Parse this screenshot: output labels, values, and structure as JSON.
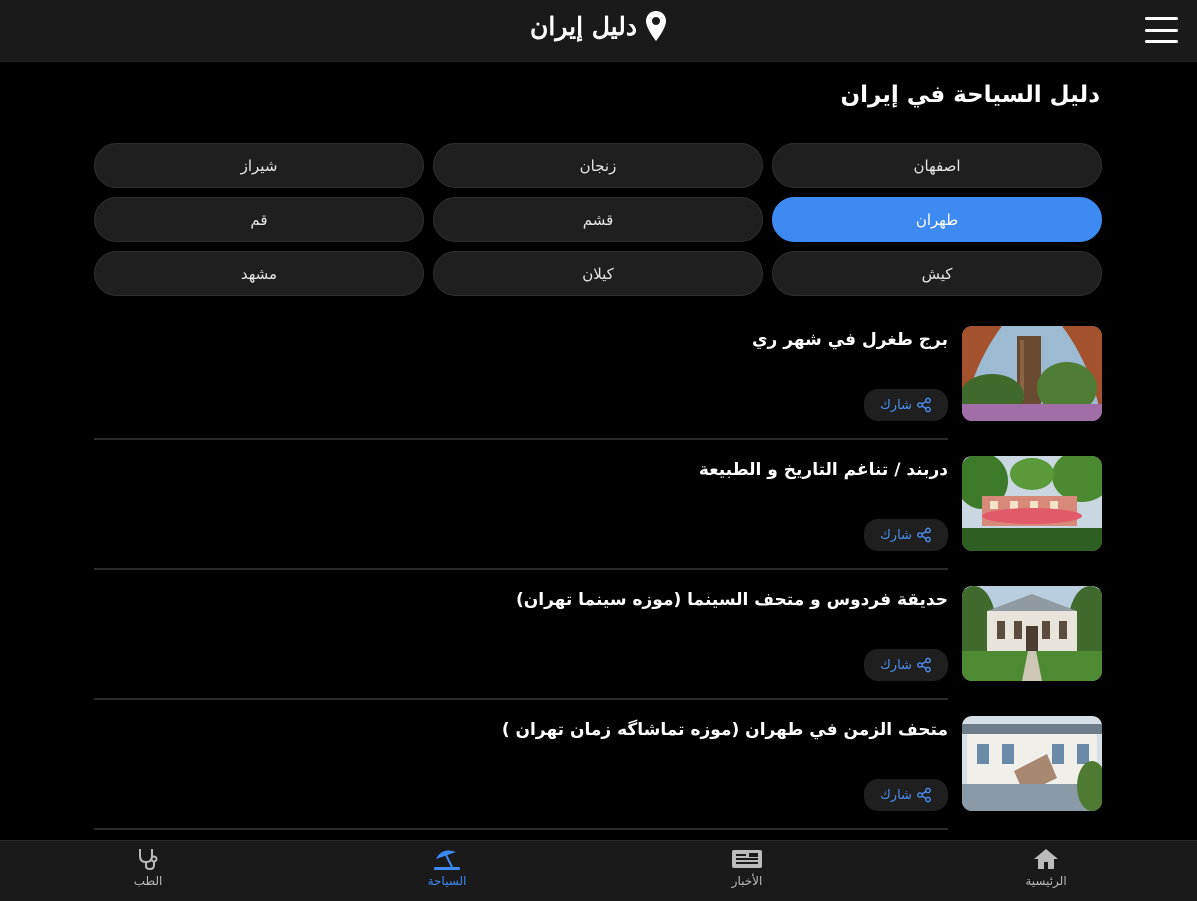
{
  "header": {
    "title": "دليل إيران",
    "logo_icon": "map-pin-icon",
    "menu_icon": "hamburger-menu-icon"
  },
  "page_title": "دليل السياحة في إيران",
  "cities": [
    {
      "label": "اصفهان",
      "active": false
    },
    {
      "label": "زنجان",
      "active": false
    },
    {
      "label": "شيراز",
      "active": false
    },
    {
      "label": "طهران",
      "active": true
    },
    {
      "label": "قشم",
      "active": false
    },
    {
      "label": "قم",
      "active": false
    },
    {
      "label": "كيش",
      "active": false
    },
    {
      "label": "كيلان",
      "active": false
    },
    {
      "label": "مشهد",
      "active": false
    }
  ],
  "places": [
    {
      "title": "برج طغرل في شهر ري",
      "share_label": "شارك"
    },
    {
      "title": "دربند / تناغم التاريخ و الطبيعة",
      "share_label": "شارك"
    },
    {
      "title": "حديقة فردوس و متحف السينما (موزه سينما تهران)",
      "share_label": "شارك"
    },
    {
      "title": "متحف الزمن في طهران (موزه تماشاگه زمان تهران )",
      "share_label": "شارك"
    }
  ],
  "bottom_nav": [
    {
      "label": "الرئيسية",
      "icon": "home-icon",
      "active": false
    },
    {
      "label": "الأخبار",
      "icon": "newspaper-icon",
      "active": false
    },
    {
      "label": "السياحة",
      "icon": "beach-umbrella-icon",
      "active": true
    },
    {
      "label": "الطب",
      "icon": "stethoscope-icon",
      "active": false
    }
  ],
  "colors": {
    "accent": "#3d8af2",
    "background": "#000000",
    "surface": "#1f1f1f"
  }
}
